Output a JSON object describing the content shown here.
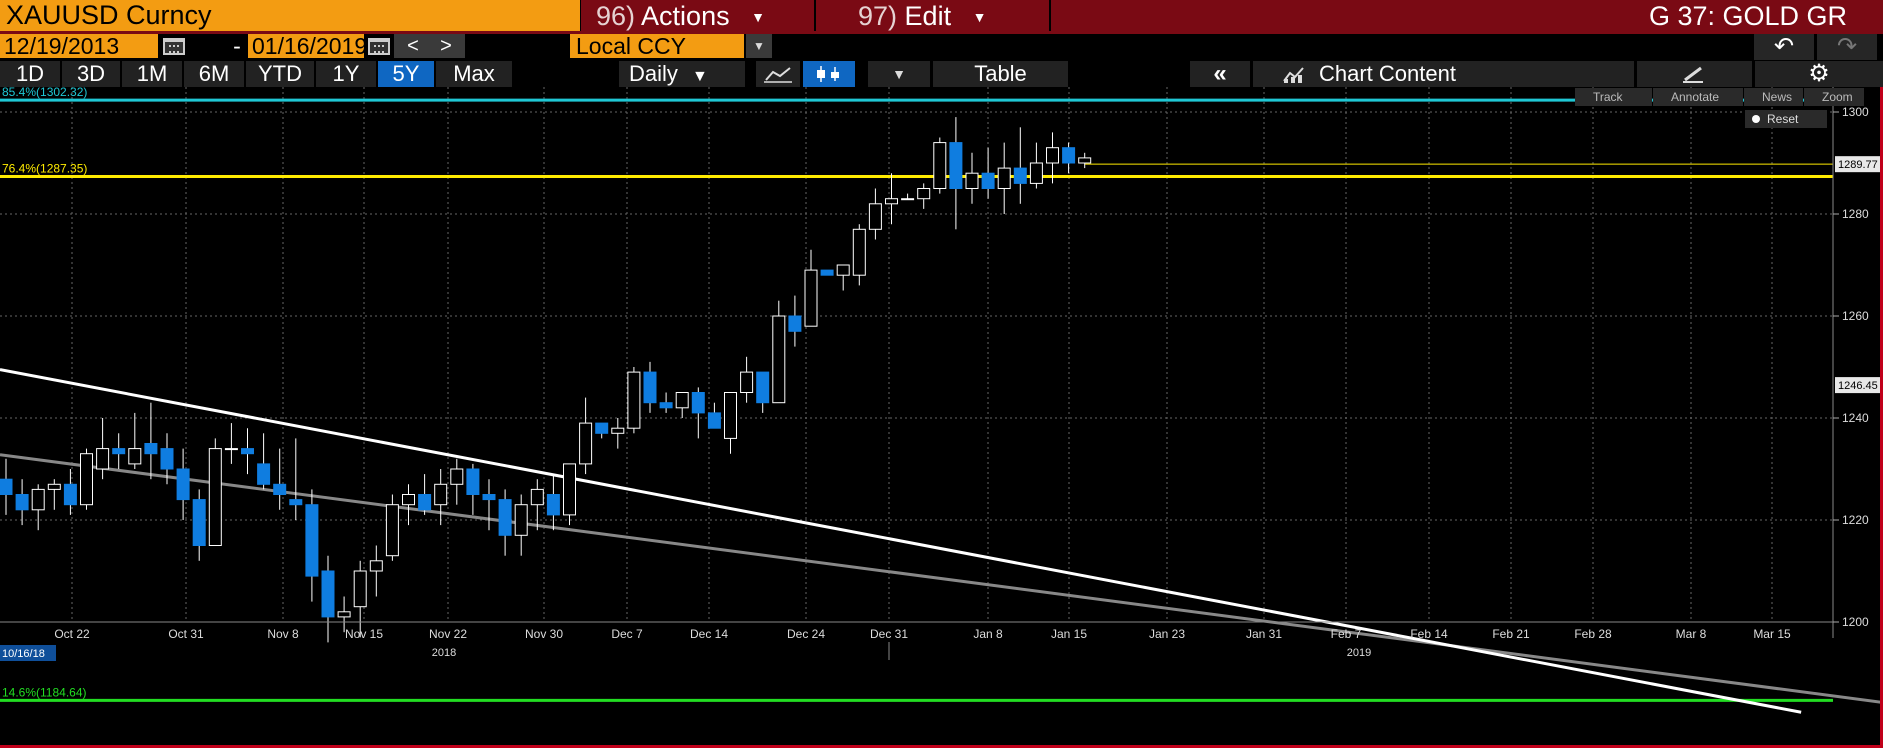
{
  "header": {
    "ticker": "XAUUSD Curncy",
    "actions_num": "96)",
    "actions_label": "Actions",
    "edit_num": "97)",
    "edit_label": "Edit",
    "page_title": "G 37: GOLD GR"
  },
  "date_range": {
    "start": "12/19/2013",
    "end": "01/16/2019",
    "currency": "Local CCY"
  },
  "toolbar": {
    "ranges": [
      "1D",
      "3D",
      "1M",
      "6M",
      "YTD",
      "1Y",
      "5Y",
      "Max"
    ],
    "active_range": "5Y",
    "frequency": "Daily",
    "table_label": "Table",
    "chart_content_label": "Chart Content"
  },
  "chart_tools": {
    "track": "Track",
    "annotate": "Annotate",
    "news": "News",
    "zoom": "Zoom",
    "reset": "Reset"
  },
  "colors": {
    "accent_orange": "#f39c12",
    "brand_crimson": "#7a0a14",
    "active_blue": "#0f67c2",
    "fib_top": "#1fc7d4",
    "fib_mid": "#ffeb00",
    "fib_low": "#22dd22"
  },
  "chart_data": {
    "type": "candlestick",
    "y_axis": {
      "min": 1182,
      "max": 1302,
      "ticks": [
        1200,
        1220,
        1240,
        1260,
        1280,
        1300
      ],
      "side": "right"
    },
    "x_ticks": [
      "Oct 22",
      "Oct 31",
      "Nov 8",
      "Nov 15",
      "Nov 22",
      "Nov 30",
      "Dec 7",
      "Dec 14",
      "Dec 24",
      "Dec 31",
      "Jan 8",
      "Jan 15",
      "Jan 23",
      "Jan 31",
      "Feb 7",
      "Feb 14",
      "Feb 21",
      "Feb 28",
      "Mar 8",
      "Mar 15"
    ],
    "year_labels": [
      "2018",
      "2019"
    ],
    "start_date_label": "10/16/18",
    "fib_levels": [
      {
        "label": "85.4%(1302.32)",
        "value": 1302.32,
        "color": "#1fc7d4"
      },
      {
        "label": "76.4%(1287.35)",
        "value": 1287.35,
        "color": "#ffeb00"
      },
      {
        "label": "14.6%(1184.64)",
        "value": 1184.64,
        "color": "#22dd22"
      }
    ],
    "price_tags": [
      {
        "label": "1289.77",
        "value": 1289.77,
        "style": "light"
      },
      {
        "label": "1246.45",
        "value": 1246.45,
        "style": "light"
      }
    ],
    "trendlines": [
      {
        "name": "white",
        "from": [
          0,
          1249.5
        ],
        "to": [
          111.5,
          1182.3
        ]
      },
      {
        "name": "gray",
        "from": [
          0,
          1232.8
        ],
        "to": [
          121.2,
          1182.3
        ]
      }
    ],
    "candles": [
      [
        1228,
        1232,
        1221,
        1225
      ],
      [
        1225,
        1228,
        1219,
        1222
      ],
      [
        1222,
        1227,
        1218,
        1226
      ],
      [
        1226,
        1228,
        1222,
        1227
      ],
      [
        1227,
        1230,
        1221,
        1223
      ],
      [
        1223,
        1234,
        1222,
        1233
      ],
      [
        1230,
        1240,
        1228,
        1234
      ],
      [
        1234,
        1237,
        1230,
        1233
      ],
      [
        1231,
        1241,
        1230,
        1234
      ],
      [
        1235,
        1243,
        1228,
        1233
      ],
      [
        1234,
        1237,
        1227,
        1230
      ],
      [
        1230,
        1234,
        1220,
        1224
      ],
      [
        1224,
        1226,
        1212,
        1215
      ],
      [
        1215,
        1236,
        1215,
        1234
      ],
      [
        1234,
        1239,
        1231,
        1234
      ],
      [
        1234,
        1238,
        1229,
        1233
      ],
      [
        1231,
        1237,
        1226,
        1227
      ],
      [
        1227,
        1234,
        1222,
        1225
      ],
      [
        1224,
        1236,
        1220,
        1223
      ],
      [
        1223,
        1226,
        1204,
        1209
      ],
      [
        1210,
        1213,
        1196,
        1201
      ],
      [
        1201,
        1205,
        1198,
        1202
      ],
      [
        1203,
        1212,
        1197,
        1210
      ],
      [
        1210,
        1215,
        1205,
        1212
      ],
      [
        1213,
        1225,
        1212,
        1223
      ],
      [
        1223,
        1227,
        1219,
        1225
      ],
      [
        1225,
        1229,
        1221,
        1222
      ],
      [
        1223,
        1230,
        1219,
        1227
      ],
      [
        1227,
        1232,
        1223,
        1230
      ],
      [
        1230,
        1231,
        1221,
        1225
      ],
      [
        1225,
        1228,
        1218,
        1224
      ],
      [
        1224,
        1226,
        1213,
        1217
      ],
      [
        1217,
        1225,
        1213,
        1223
      ],
      [
        1223,
        1228,
        1218,
        1226
      ],
      [
        1225,
        1229,
        1218,
        1221
      ],
      [
        1221,
        1231,
        1219,
        1231
      ],
      [
        1231,
        1244,
        1229,
        1239
      ],
      [
        1239,
        1239,
        1236,
        1237
      ],
      [
        1237,
        1240,
        1234,
        1238
      ],
      [
        1238,
        1250,
        1237,
        1249
      ],
      [
        1249,
        1251,
        1241,
        1243
      ],
      [
        1243,
        1245,
        1241,
        1242
      ],
      [
        1242,
        1245,
        1240,
        1245
      ],
      [
        1245,
        1246,
        1236,
        1241
      ],
      [
        1241,
        1243,
        1238,
        1238
      ],
      [
        1236,
        1244,
        1233,
        1245
      ],
      [
        1245,
        1252,
        1243,
        1249
      ],
      [
        1249,
        1249,
        1241,
        1243
      ],
      [
        1243,
        1263,
        1243,
        1260
      ],
      [
        1260,
        1264,
        1254,
        1257
      ],
      [
        1258,
        1273,
        1258,
        1269
      ],
      [
        1269,
        1269,
        1268,
        1268
      ],
      [
        1268,
        1270,
        1265,
        1270
      ],
      [
        1268,
        1278,
        1266,
        1277
      ],
      [
        1277,
        1285,
        1275,
        1282
      ],
      [
        1282,
        1288,
        1278,
        1283
      ],
      [
        1283,
        1284,
        1283,
        1283
      ],
      [
        1283,
        1286,
        1281,
        1285
      ],
      [
        1285,
        1295,
        1284,
        1294
      ],
      [
        1294,
        1299,
        1277,
        1285
      ],
      [
        1285,
        1292,
        1282,
        1288
      ],
      [
        1288,
        1293,
        1283,
        1285
      ],
      [
        1285,
        1294,
        1280,
        1289
      ],
      [
        1289,
        1297,
        1282,
        1286
      ],
      [
        1286,
        1294,
        1285,
        1290
      ],
      [
        1290,
        1296,
        1286,
        1293
      ],
      [
        1293,
        1294,
        1288,
        1290
      ],
      [
        1290,
        1292,
        1289,
        1291
      ]
    ]
  }
}
